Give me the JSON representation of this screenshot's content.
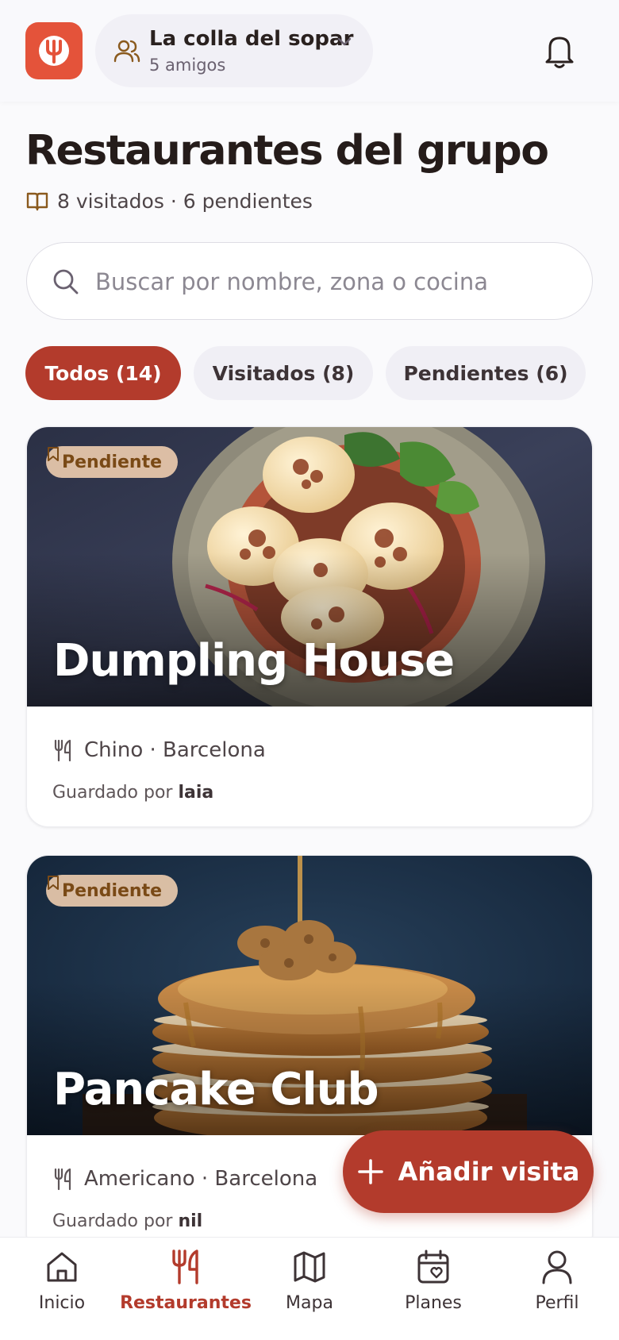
{
  "header": {
    "group_name": "La colla del sopar",
    "group_members": "5 amigos"
  },
  "page": {
    "title": "Restaurantes del grupo",
    "stats": "8 visitados · 6 pendientes"
  },
  "search": {
    "placeholder": "Buscar por nombre, zona o cocina",
    "value": ""
  },
  "tabs": [
    {
      "label": "Todos (14)",
      "active": true
    },
    {
      "label": "Visitados (8)",
      "active": false
    },
    {
      "label": "Pendientes (6)",
      "active": false
    }
  ],
  "restaurants": [
    {
      "name": "Dumpling House",
      "status": "Pendiente",
      "meta": "Chino · Barcelona",
      "saved_prefix": "Guardado por",
      "saved_by": "laia"
    },
    {
      "name": "Pancake Club",
      "status": "Pendiente",
      "meta": "Americano · Barcelona",
      "saved_prefix": "Guardado por",
      "saved_by": "nil"
    }
  ],
  "fab": {
    "label": "Añadir visita"
  },
  "nav": [
    {
      "label": "Inicio",
      "icon": "home-icon"
    },
    {
      "label": "Restaurantes",
      "icon": "utensils-icon",
      "active": true
    },
    {
      "label": "Mapa",
      "icon": "map-icon"
    },
    {
      "label": "Planes",
      "icon": "calendar-heart-icon"
    },
    {
      "label": "Perfil",
      "icon": "user-icon"
    }
  ],
  "colors": {
    "accent": "#b33b2c",
    "logo": "#e4533a",
    "badge_bg": "#f4d2b2",
    "badge_text": "#7a4a16"
  }
}
